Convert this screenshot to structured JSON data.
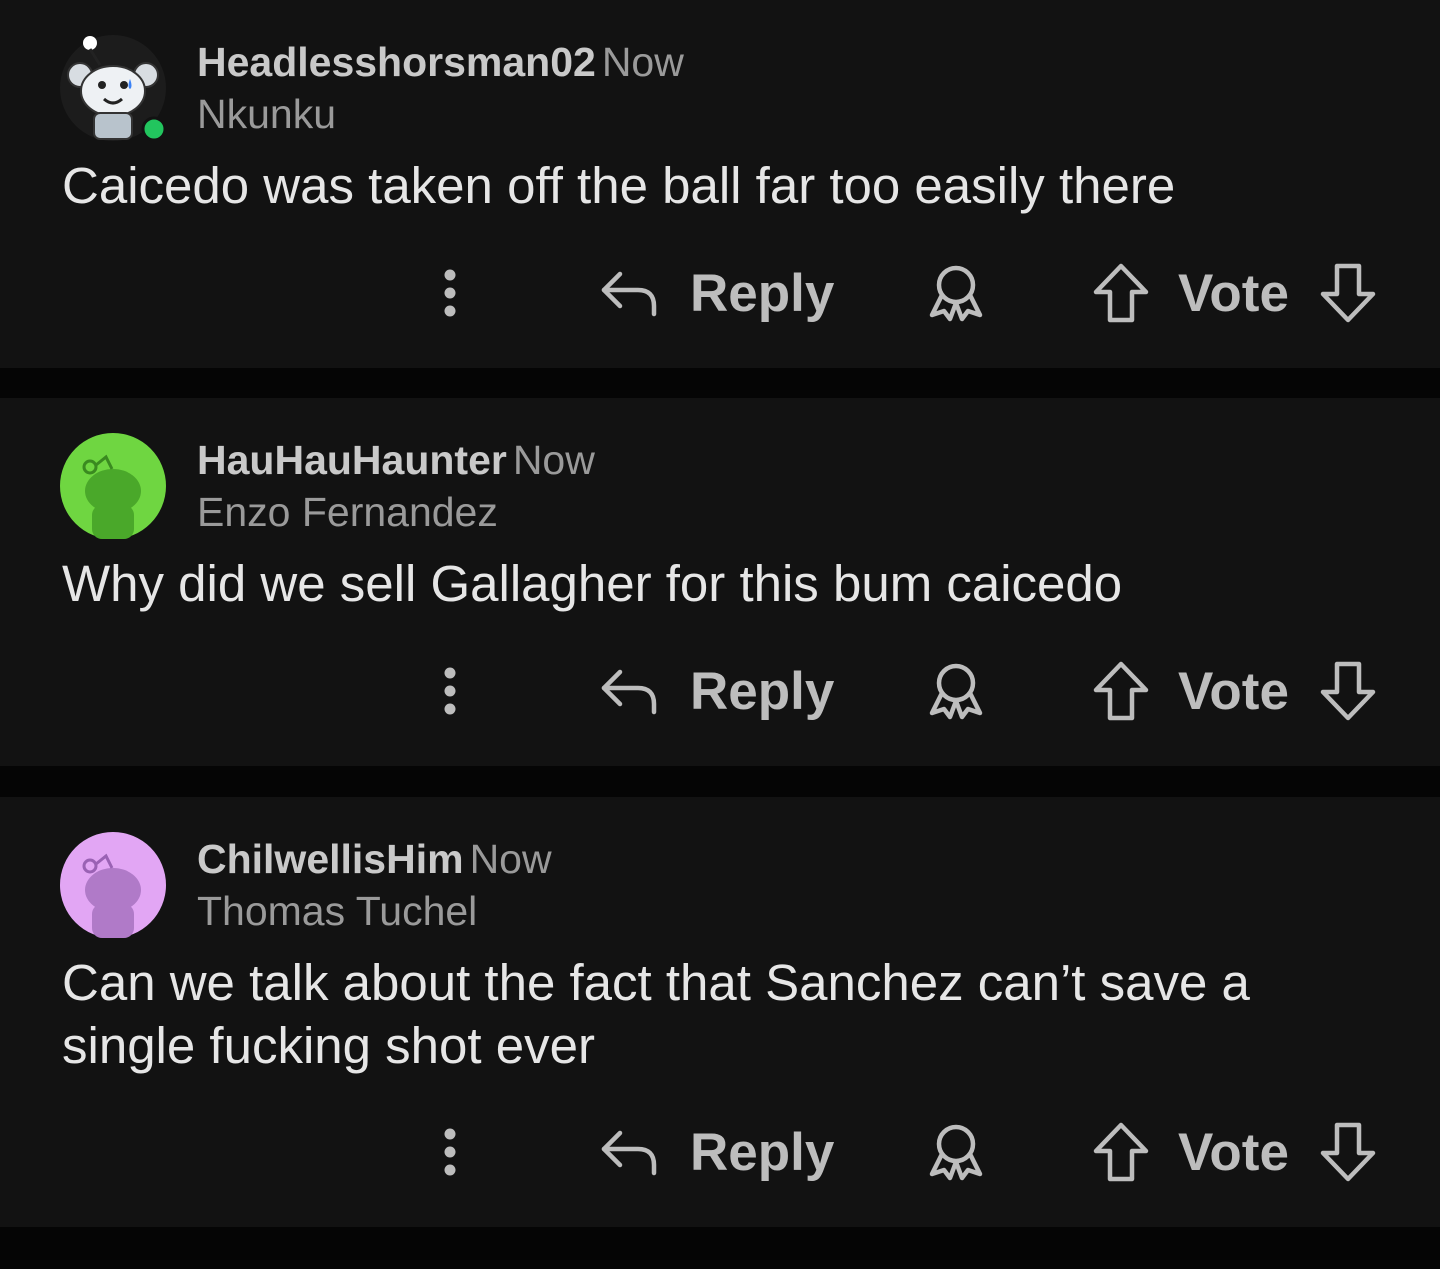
{
  "comments": [
    {
      "username": "Headlesshorsman02",
      "time": "Now",
      "flair": "Nkunku",
      "text": "Caicedo was taken off the ball far too easily there",
      "online": true
    },
    {
      "username": "HauHauHaunter",
      "time": "Now",
      "flair": "Enzo Fernandez",
      "text": "Why did we sell Gallagher for this bum caicedo"
    },
    {
      "username": "ChilwellisHim",
      "time": "Now",
      "flair": "Thomas Tuchel",
      "text": "Can we talk about the fact that Sanchez can’t save a single fucking shot ever"
    }
  ],
  "actions": {
    "reply_label": "Reply",
    "vote_label": "Vote"
  },
  "colors": {
    "background": "#121212",
    "separator": "#050505",
    "avatar_green": "#6fd641",
    "avatar_purple": "#e2a6f4",
    "online_dot": "#22c55e"
  },
  "icons": [
    "more-vertical-icon",
    "reply-arrow-icon",
    "award-icon",
    "upvote-icon",
    "downvote-icon",
    "snoo-avatar-icon",
    "online-status-icon"
  ]
}
